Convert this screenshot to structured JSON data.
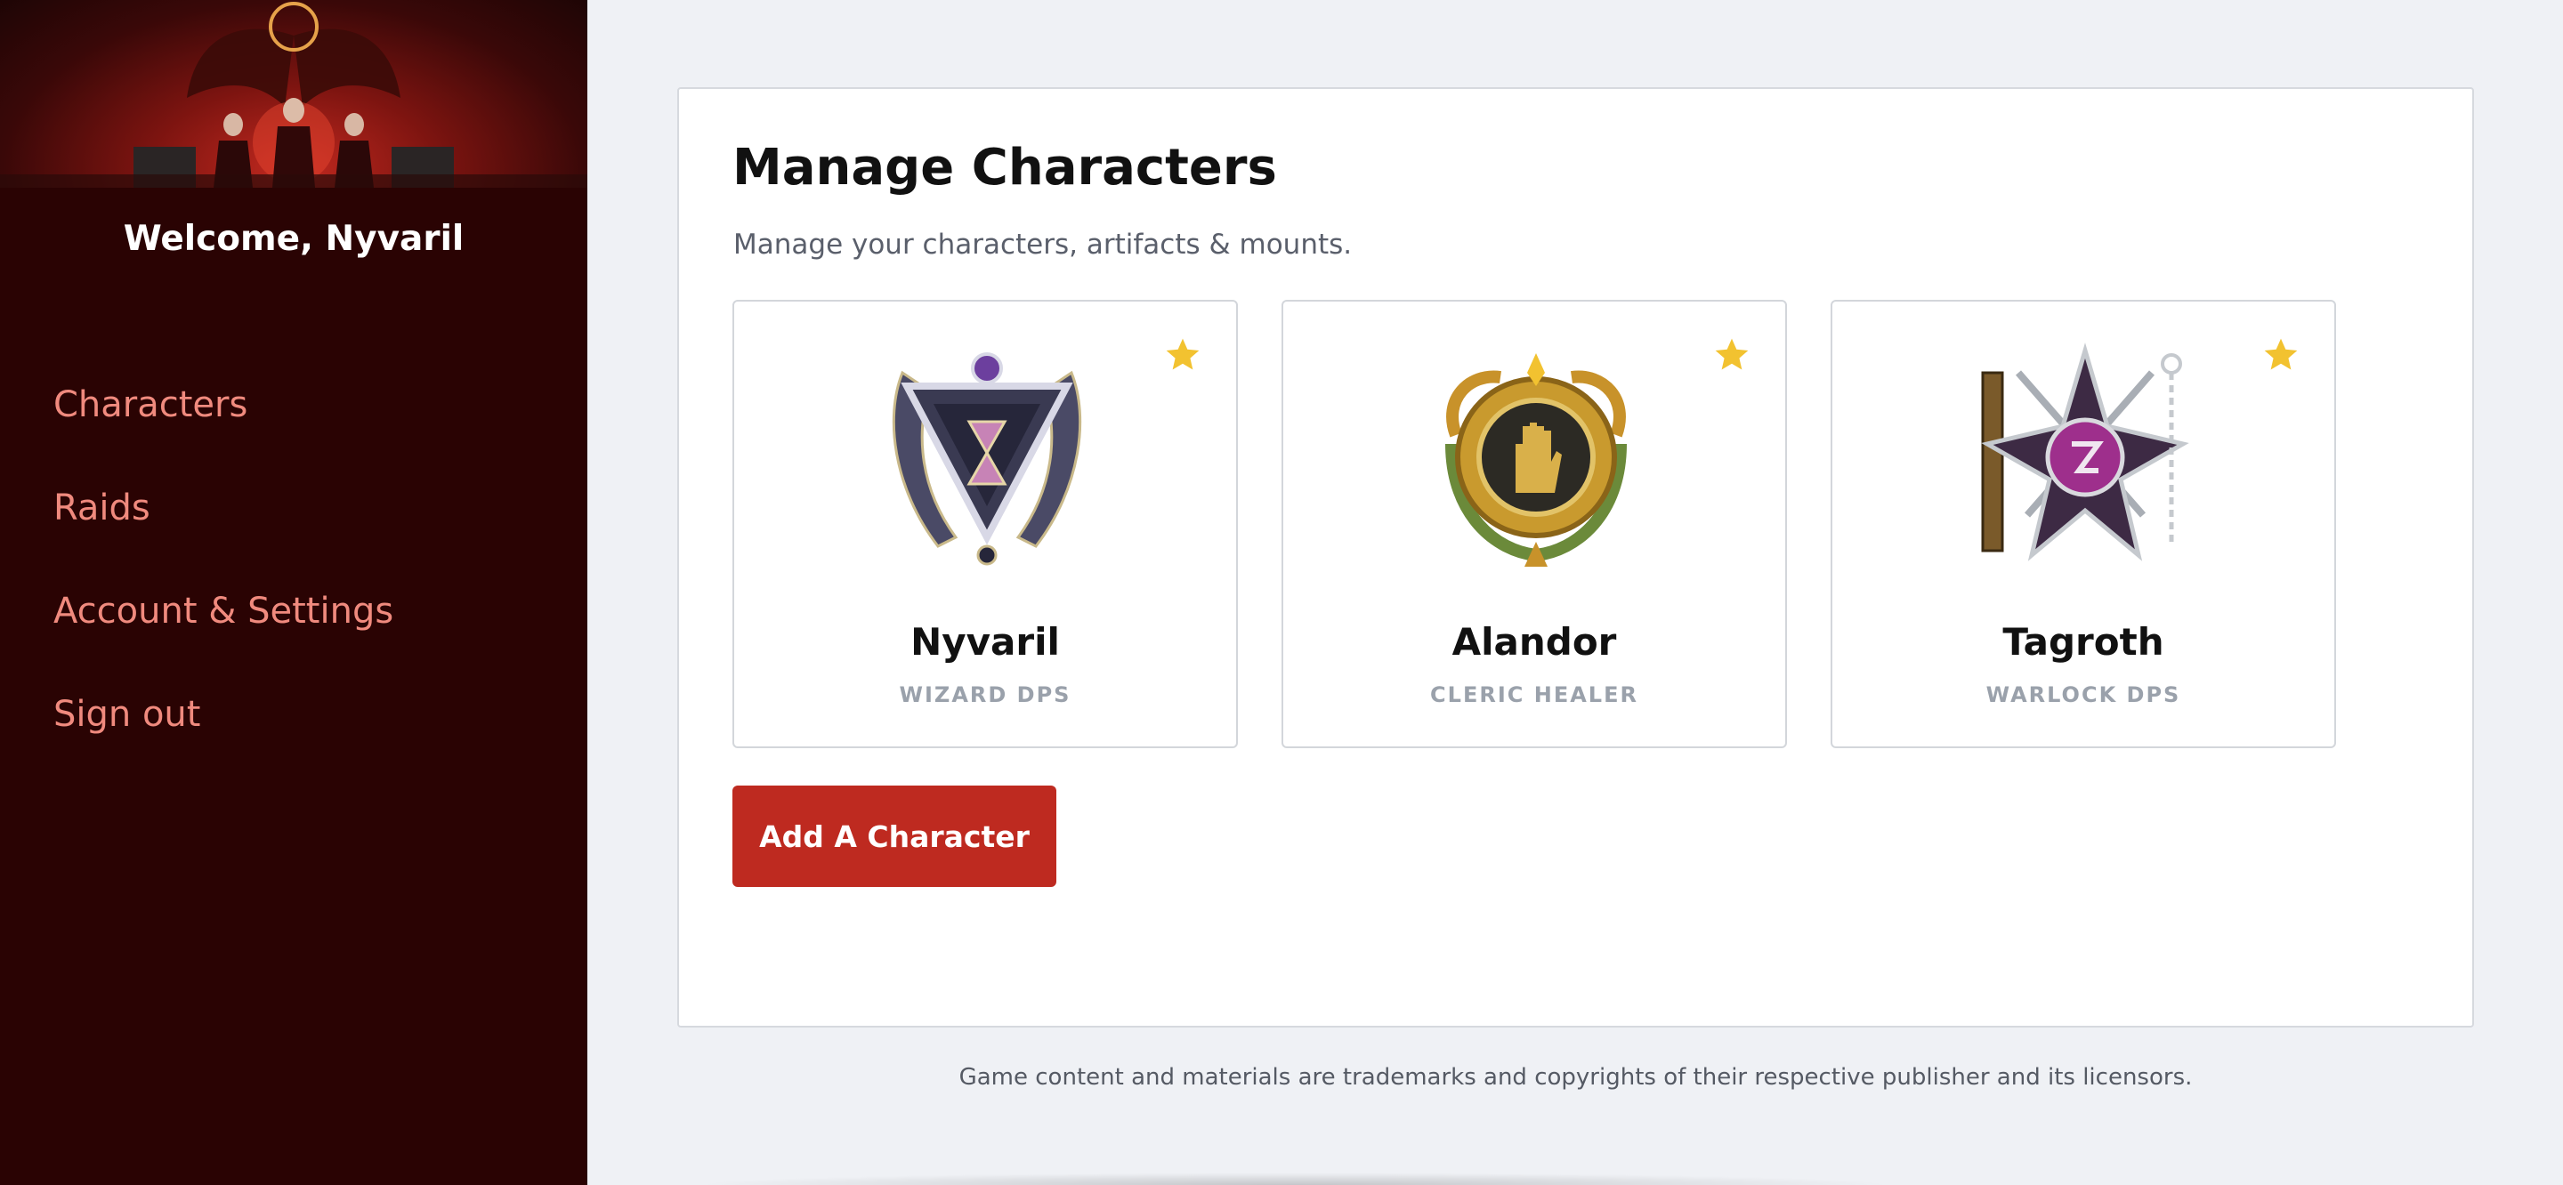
{
  "sidebar": {
    "welcome": "Welcome, Nyvaril",
    "items": [
      {
        "label": "Characters"
      },
      {
        "label": "Raids"
      },
      {
        "label": "Account & Settings"
      },
      {
        "label": "Sign out"
      }
    ]
  },
  "main": {
    "title": "Manage Characters",
    "subtitle": "Manage your characters, artifacts & mounts.",
    "characters": [
      {
        "name": "Nyvaril",
        "class": "WIZARD DPS",
        "favorite": true,
        "emblem": "wizard-emblem-icon"
      },
      {
        "name": "Alandor",
        "class": "CLERIC HEALER",
        "favorite": true,
        "emblem": "cleric-emblem-icon"
      },
      {
        "name": "Tagroth",
        "class": "WARLOCK DPS",
        "favorite": true,
        "emblem": "warlock-emblem-icon"
      }
    ],
    "add_button": "Add A Character"
  },
  "footer": "Game content and materials are trademarks and copyrights of their respective publisher and its licensors.",
  "colors": {
    "sidebar_bg": "#2a0303",
    "nav_text": "#f08a7e",
    "accent": "#be2a20",
    "star": "#f2c230",
    "page_bg": "#eff1f5"
  }
}
